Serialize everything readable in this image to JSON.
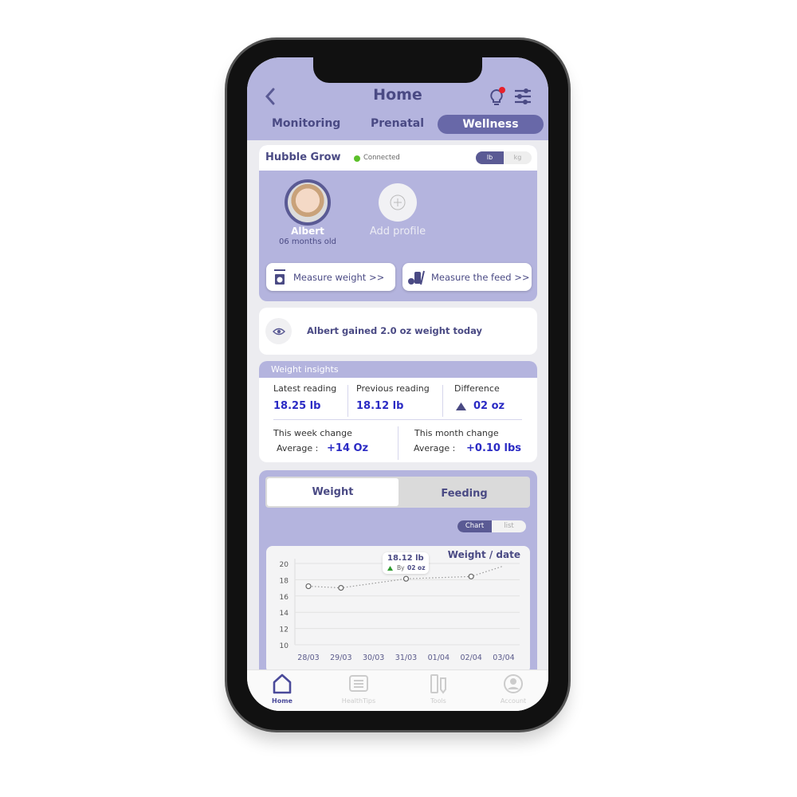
{
  "header": {
    "title": "Home",
    "tabs": [
      {
        "label": "Monitoring"
      },
      {
        "label": "Prenatal"
      },
      {
        "label": "Wellness",
        "active": true
      }
    ]
  },
  "colors": {
    "accent": "#b4b4de",
    "active_tab": "#6868a8",
    "text_navy": "#4a4a84",
    "value_blue": "#2b2bc4",
    "connected": "#5cc02a",
    "notification": "#e8202a"
  },
  "device": {
    "name": "Hubble Grow",
    "status": "Connected",
    "units": [
      "lb",
      "kg"
    ],
    "selected_unit": "lb"
  },
  "profiles": [
    {
      "name": "Albert",
      "age": "06 months old"
    },
    {
      "name": "Add profile"
    }
  ],
  "actions": {
    "measure_weight": "Measure weight >>",
    "measure_feed": "Measure the feed >>"
  },
  "insight_message": "Albert gained 2.0 oz weight today",
  "weight_insights": {
    "title": "Weight insights",
    "latest_label": "Latest reading",
    "latest_value": "18.25 lb",
    "previous_label": "Previous reading",
    "previous_value": "18.12 lb",
    "difference_label": "Difference",
    "difference_value": "02 oz",
    "week_label": "This week change",
    "week_avg_label": "Average :",
    "week_avg_value": "+14 Oz",
    "month_label": "This month change",
    "month_avg_label": "Average :",
    "month_avg_value": "+0.10 lbs"
  },
  "chart_tabs": {
    "weight": "Weight",
    "feeding": "Feeding",
    "view_chart": "Chart",
    "view_list": "list"
  },
  "chart_data": {
    "type": "line",
    "title": "Weight / date",
    "categories": [
      "28/03",
      "29/03",
      "30/03",
      "31/03",
      "01/04",
      "02/04",
      "03/04"
    ],
    "y_ticks": [
      20,
      18,
      16,
      14,
      12,
      10
    ],
    "ylim": [
      10,
      20
    ],
    "points": [
      {
        "x": "28/03",
        "y": 17.2
      },
      {
        "x": "29/03",
        "y": 17.0
      },
      {
        "x": "31/03",
        "y": 18.12
      },
      {
        "x": "02/04",
        "y": 18.4
      },
      {
        "x": "03/04",
        "y": 19.7,
        "marker": false
      }
    ],
    "grid": true,
    "tooltip": {
      "value": "18.12 lb",
      "by_label": "By",
      "by_value": "02 oz"
    }
  },
  "bottom_nav": [
    {
      "label": "Home",
      "icon": "home-icon",
      "active": true
    },
    {
      "label": "HealthTips",
      "icon": "health-tips-icon"
    },
    {
      "label": "Tools",
      "icon": "tools-icon"
    },
    {
      "label": "Account",
      "icon": "account-icon"
    }
  ]
}
